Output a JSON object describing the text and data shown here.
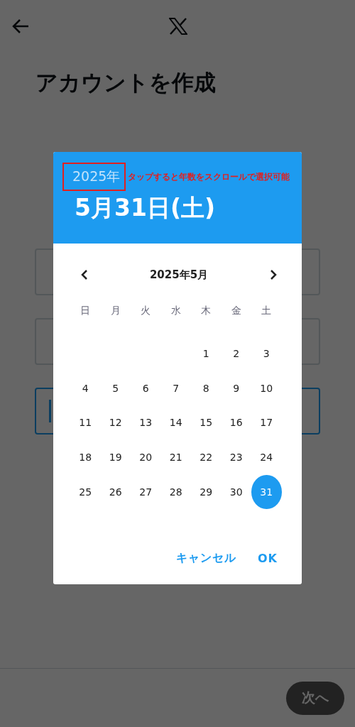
{
  "page": {
    "title": "アカウントを作成",
    "fields": [
      {
        "active": false
      },
      {
        "active": false
      },
      {
        "active": true
      }
    ],
    "next_button": {
      "label": "次へ",
      "disabled": true
    }
  },
  "date_picker": {
    "year": "2025年",
    "year_highlighted": true,
    "annotation": "タップすると年数をスクロールで選択可能",
    "date": "5月31日(土)",
    "month_label": "2025年5月",
    "weekdays": [
      "日",
      "月",
      "火",
      "水",
      "木",
      "金",
      "土"
    ],
    "weeks": [
      [
        {
          "day": "1",
          "selected": false
        },
        {
          "day": "2",
          "selected": false
        },
        {
          "day": "3",
          "selected": false
        }
      ],
      [
        {
          "day": "4",
          "selected": false
        },
        {
          "day": "5",
          "selected": false
        },
        {
          "day": "6",
          "selected": false
        },
        {
          "day": "7",
          "selected": false
        },
        {
          "day": "8",
          "selected": false
        },
        {
          "day": "9",
          "selected": false
        },
        {
          "day": "10",
          "selected": false
        }
      ],
      [
        {
          "day": "11",
          "selected": false
        },
        {
          "day": "12",
          "selected": false
        },
        {
          "day": "13",
          "selected": false
        },
        {
          "day": "14",
          "selected": false
        },
        {
          "day": "15",
          "selected": false
        },
        {
          "day": "16",
          "selected": false
        },
        {
          "day": "17",
          "selected": false
        }
      ],
      [
        {
          "day": "18",
          "selected": false
        },
        {
          "day": "19",
          "selected": false
        },
        {
          "day": "20",
          "selected": false
        },
        {
          "day": "21",
          "selected": false
        },
        {
          "day": "22",
          "selected": false
        },
        {
          "day": "23",
          "selected": false
        },
        {
          "day": "24",
          "selected": false
        }
      ],
      [
        {
          "day": "25",
          "selected": false
        },
        {
          "day": "26",
          "selected": false
        },
        {
          "day": "27",
          "selected": false
        },
        {
          "day": "28",
          "selected": false
        },
        {
          "day": "29",
          "selected": false
        },
        {
          "day": "30",
          "selected": false
        },
        {
          "day": "31",
          "selected": true
        }
      ]
    ],
    "buttons": [
      "キャンセル",
      "OK"
    ]
  }
}
